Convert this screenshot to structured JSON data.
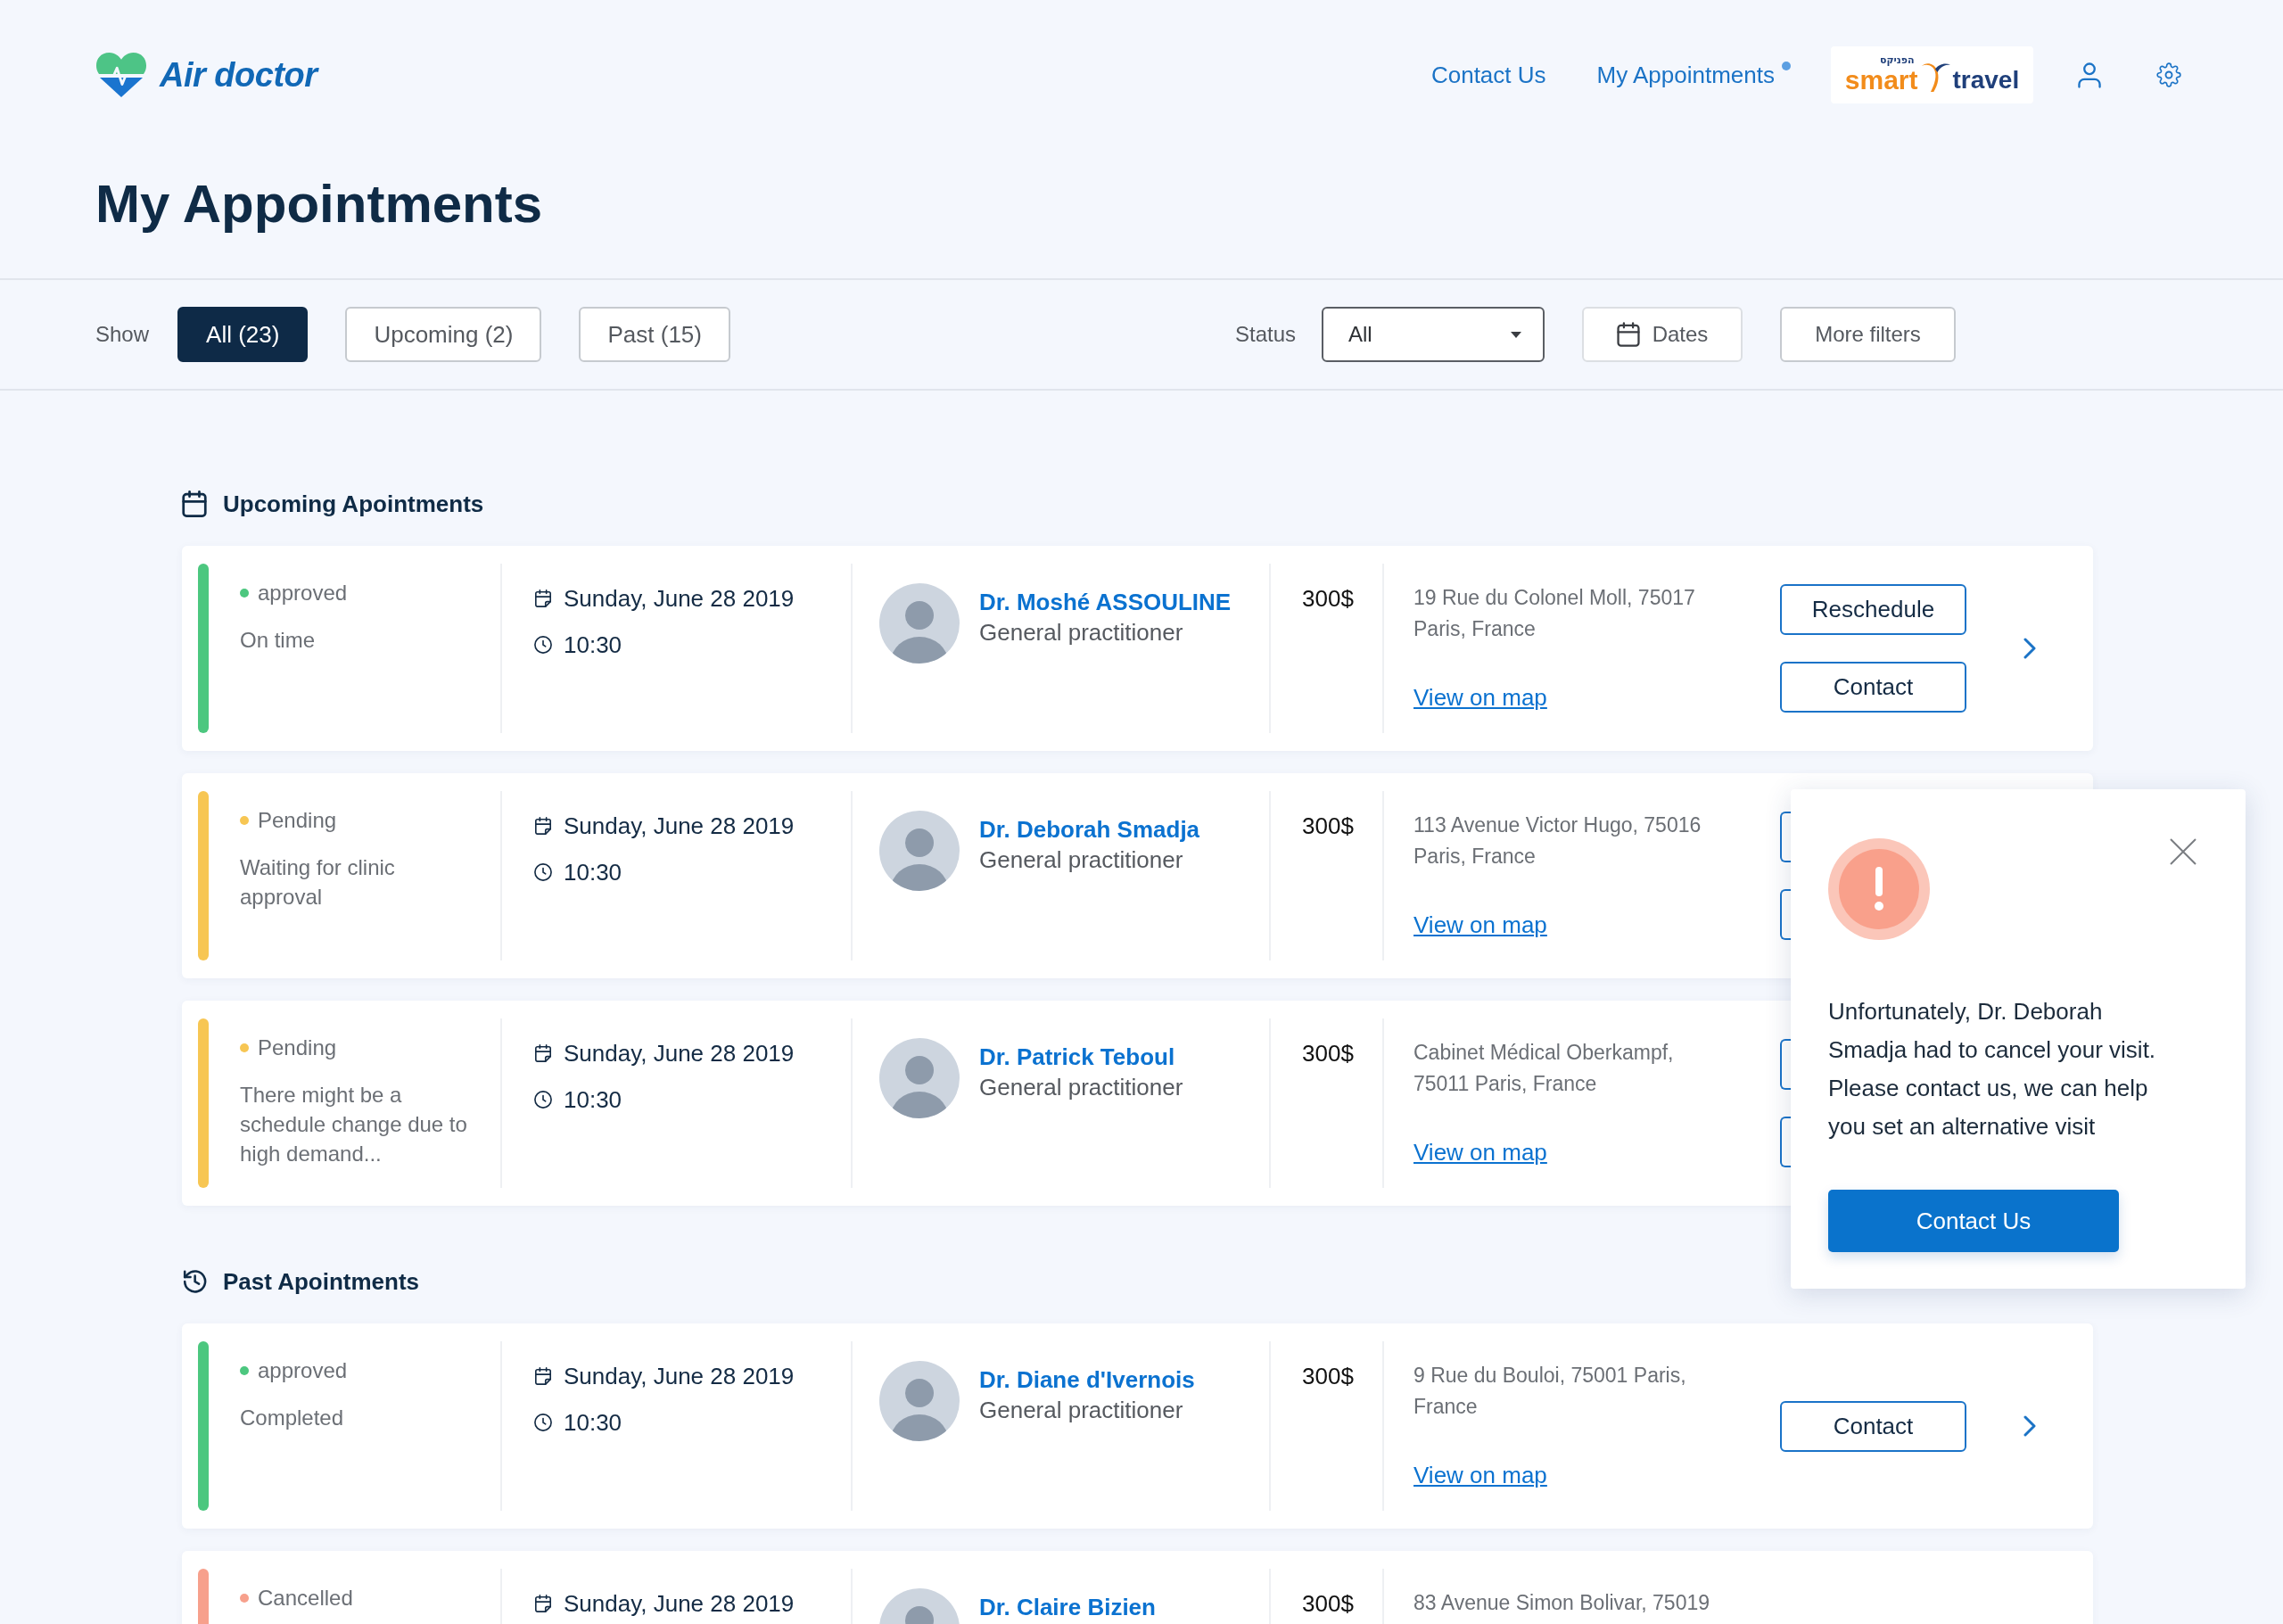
{
  "header": {
    "logo": {
      "text": "Air doctor"
    },
    "nav": [
      {
        "label": "Contact Us",
        "selected": false
      },
      {
        "label": "My Appointments",
        "selected": true
      }
    ],
    "partner_logo": {
      "tagline": "הפניקס",
      "word_1": "smart",
      "word_2": "travel"
    }
  },
  "page_title": "My Appointments",
  "filters": {
    "show_label": "Show",
    "show_options": [
      {
        "label": "All (23)",
        "selected": true
      },
      {
        "label": "Upcoming (2)",
        "selected": false
      },
      {
        "label": "Past (15)",
        "selected": false
      }
    ],
    "status_label": "Status",
    "status_select": {
      "value": "All"
    },
    "dates_button": "Dates",
    "more_filters_button": "More filters"
  },
  "sections": [
    {
      "kind": "upcoming",
      "title": "Upcoming Apointments",
      "appointments": [
        {
          "status": "approved",
          "color": "#4cc77f",
          "note": "On time",
          "date": "Sunday, June 28 2019",
          "time": "10:30",
          "doctor": "Dr. Moshé ASSOULINE",
          "specialty": "General practitioner",
          "price": "300$",
          "address": "19 Rue du Colonel Moll, 75017 Paris, France",
          "map_link": "View on map",
          "actions": [
            "Reschedule",
            "Contact"
          ],
          "covered_buttons": false
        },
        {
          "status": "Pending",
          "color": "#f7c653",
          "note": "Waiting for clinic approval",
          "date": "Sunday, June 28 2019",
          "time": "10:30",
          "doctor": "Dr. Deborah Smadja",
          "specialty": "General practitioner",
          "price": "300$",
          "address": "113 Avenue Victor Hugo, 75016 Paris, France",
          "map_link": "View on map",
          "covered_buttons": true
        },
        {
          "status": "Pending",
          "color": "#f7c653",
          "note": "There might be a schedule change due to high demand...",
          "date": "Sunday, June 28 2019",
          "time": "10:30",
          "doctor": "Dr. Patrick Teboul",
          "specialty": "General practitioner",
          "price": "300$",
          "address": "Cabinet Médical Oberkampf, 75011 Paris, France",
          "map_link": "View on map",
          "covered_buttons": true
        }
      ]
    },
    {
      "kind": "past",
      "title": "Past Apointments",
      "appointments": [
        {
          "status": "approved",
          "color": "#4cc77f",
          "note": "Completed",
          "date": "Sunday, June 28 2019",
          "time": "10:30",
          "doctor": "Dr. Diane d'Ivernois",
          "specialty": "General practitioner",
          "price": "300$",
          "address": "9 Rue du Bouloi, 75001 Paris, France",
          "map_link": "View on map",
          "actions": [
            "Contact"
          ],
          "covered_buttons": false
        },
        {
          "status": "Cancelled",
          "color": "#f7a08c",
          "date": "Sunday, June 28 2019",
          "doctor": "Dr. Claire Bizien",
          "price": "300$",
          "address": "83 Avenue Simon Bolivar, 75019",
          "covered_buttons": false
        }
      ]
    }
  ],
  "alert_popup": {
    "message": "Unfortunately, Dr. Deborah Smadja had to cancel your visit. Please contact us, we can help you set an alternative visit",
    "button": "Contact Us"
  }
}
